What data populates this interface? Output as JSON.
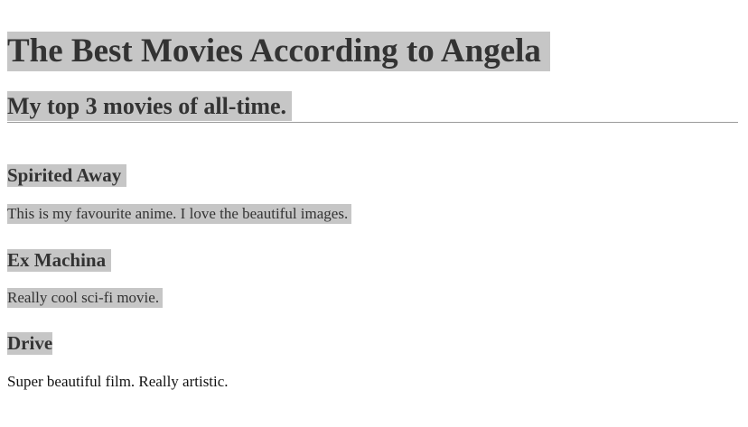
{
  "header": {
    "title": "The Best Movies According to Angela",
    "subtitle": "My top 3 movies of all-time."
  },
  "movies": [
    {
      "title": "Spirited Away",
      "description": "This is my favourite anime. I love the beautiful images."
    },
    {
      "title": "Ex Machina",
      "description": "Really cool sci-fi movie."
    },
    {
      "title": "Drive",
      "description": "Super beautiful film. Really artistic."
    }
  ],
  "colors": {
    "highlight": "#c6c6c6",
    "text": "#333333",
    "rule": "#9a9a9a"
  }
}
